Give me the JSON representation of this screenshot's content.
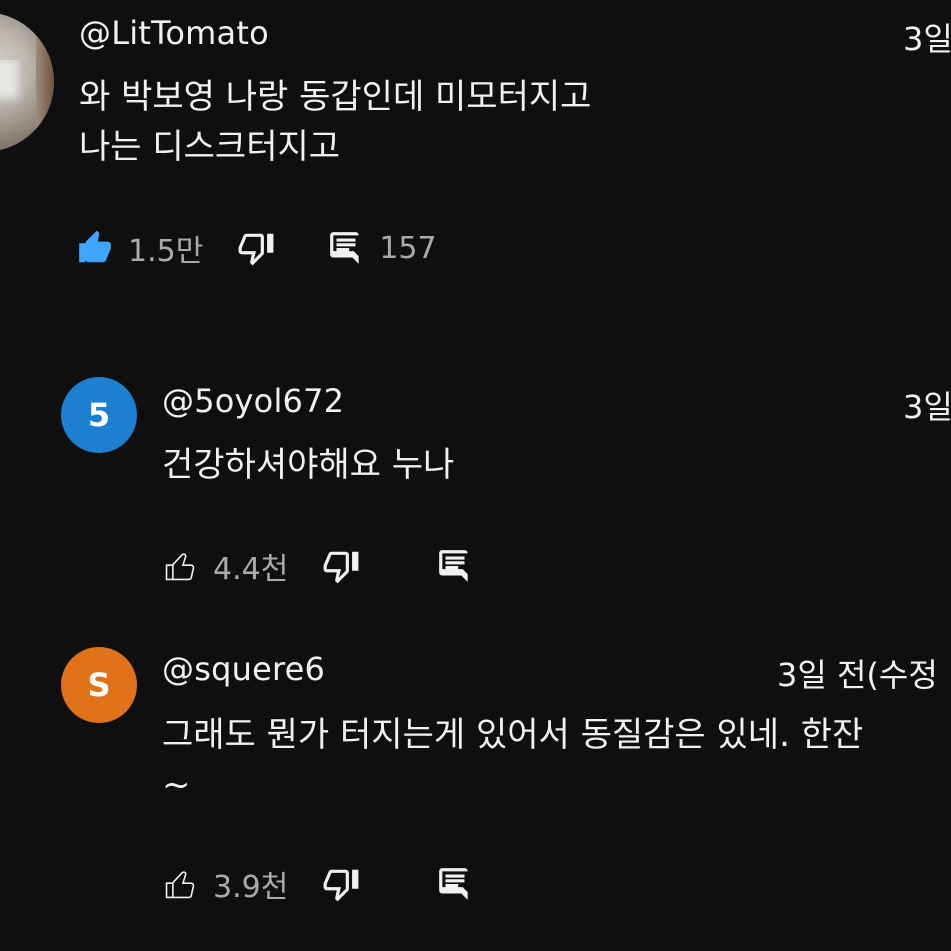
{
  "comments": [
    {
      "handle": "@LitTomato",
      "time": "3일",
      "avatar": {
        "type": "photo"
      },
      "lines": [
        "와 박보영 나랑 동갑인데 미모터지고",
        "나는 디스크터지고"
      ],
      "likes": "1.5만",
      "liked": true,
      "replies": "157"
    },
    {
      "handle": "@5oyol672",
      "time": "3일",
      "avatar": {
        "type": "letter",
        "letter": "5",
        "color": "#1c7fd0"
      },
      "lines": [
        "건강하셔야해요 누나"
      ],
      "likes": "4.4천",
      "liked": false,
      "replies": ""
    },
    {
      "handle": "@squere6",
      "time": "3일 전(수정",
      "avatar": {
        "type": "letter",
        "letter": "S",
        "color": "#e0731a"
      },
      "lines": [
        "그래도 뭔가 터지는게 있어서 동질감은 있네. 한잔",
        "~"
      ],
      "likes": "3.9천",
      "liked": false,
      "replies": ""
    }
  ],
  "icons": {
    "like": "thumbs-up-icon",
    "dislike": "thumbs-down-icon",
    "reply": "reply-icon"
  },
  "colors": {
    "background": "#0f0f0f",
    "liked": "#3ea6ff",
    "muted": "#aaaaaa"
  }
}
